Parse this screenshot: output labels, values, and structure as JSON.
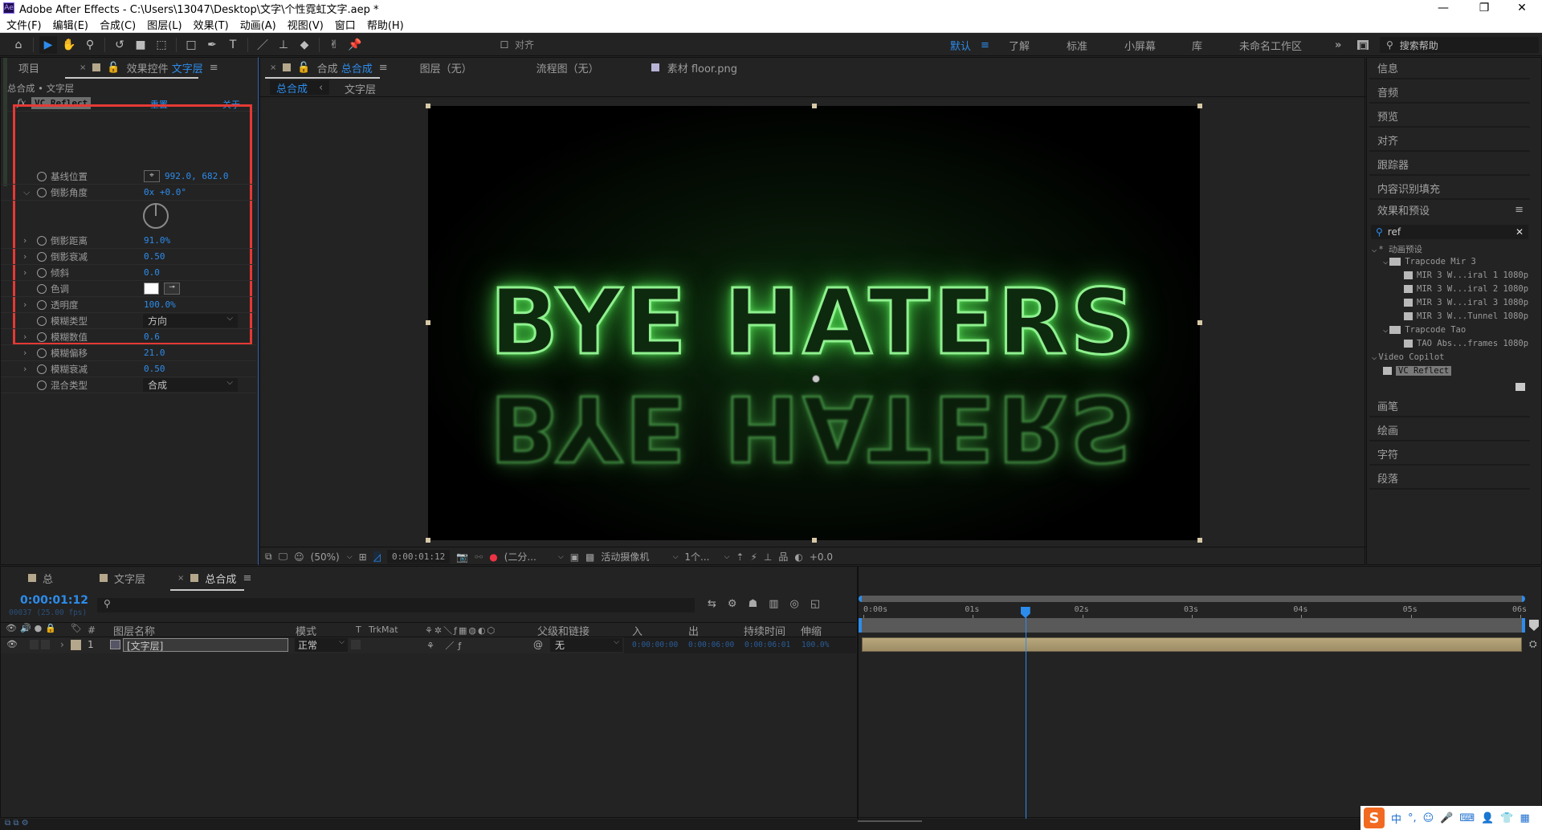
{
  "window": {
    "app_icon": "Ae",
    "title": "Adobe After Effects - C:\\Users\\13047\\Desktop\\文字\\个性霓虹文字.aep *",
    "controls": {
      "minimize": "—",
      "restore": "❐",
      "close": "✕"
    }
  },
  "menu": [
    "文件(F)",
    "编辑(E)",
    "合成(C)",
    "图层(L)",
    "效果(T)",
    "动画(A)",
    "视图(V)",
    "窗口",
    "帮助(H)"
  ],
  "toolbar": {
    "align_label": "对齐",
    "workspaces": [
      {
        "label": "默认",
        "active": true
      },
      {
        "label": "了解",
        "active": false
      },
      {
        "label": "标准",
        "active": false
      },
      {
        "label": "小屏幕",
        "active": false
      },
      {
        "label": "库",
        "active": false
      },
      {
        "label": "未命名工作区",
        "active": false
      }
    ],
    "more": "»",
    "search_help_placeholder": "搜索帮助"
  },
  "left_panel": {
    "tab_project": "项目",
    "tab_effects_prefix": "效果控件",
    "tab_effects_layer": "文字层",
    "breadcrumb": "总合成 • 文字层",
    "effect_name": "VC Reflect",
    "reset_label": "重置",
    "about_label": "关于",
    "properties": [
      {
        "label": "基线位置",
        "value": "992.0, 682.0",
        "type": "point",
        "expandable": false
      },
      {
        "label": "倒影角度",
        "value": "0x +0.0°",
        "type": "angle",
        "expandable": true,
        "expanded": true
      },
      {
        "label": "倒影距离",
        "value": "91.0%",
        "type": "number",
        "expandable": true
      },
      {
        "label": "倒影衰减",
        "value": "0.50",
        "type": "number",
        "expandable": true
      },
      {
        "label": "倾斜",
        "value": "0.0",
        "type": "number",
        "expandable": true
      },
      {
        "label": "色调",
        "value": "#ffffff",
        "type": "color",
        "expandable": false
      },
      {
        "label": "透明度",
        "value": "100.0%",
        "type": "number",
        "expandable": true
      },
      {
        "label": "模糊类型",
        "value": "方向",
        "type": "dropdown",
        "expandable": false
      },
      {
        "label": "模糊数值",
        "value": "0.6",
        "type": "number",
        "expandable": true
      },
      {
        "label": "模糊偏移",
        "value": "21.0",
        "type": "number",
        "expandable": true
      },
      {
        "label": "模糊衰减",
        "value": "0.50",
        "type": "number",
        "expandable": true
      },
      {
        "label": "混合类型",
        "value": "合成",
        "type": "dropdown",
        "expandable": false
      }
    ]
  },
  "viewer": {
    "tab_comp_prefix": "合成",
    "tab_comp_name": "总合成",
    "tab_layer": "图层（无）",
    "tab_flow": "流程图（无）",
    "tab_footage": "素材 floor.png",
    "crumb_active": "总合成",
    "crumb_next": "文字层",
    "canvas_text": "BYE HATERS",
    "footer": {
      "zoom": "(50%)",
      "timecode": "0:00:01:12",
      "resolution": "(二分...",
      "camera": "活动摄像机",
      "views": "1个...",
      "exposure": "+0.0"
    }
  },
  "right_panel": {
    "items_top": [
      "信息",
      "音频",
      "预览",
      "对齐",
      "跟踪器",
      "内容识别填充"
    ],
    "effects_title": "效果和预设",
    "search_value": "ref",
    "tree": [
      {
        "level": 0,
        "label": "* 动画预设",
        "kind": "group"
      },
      {
        "level": 1,
        "label": "Trapcode Mir 3",
        "kind": "folder"
      },
      {
        "level": 2,
        "label": "MIR 3 W...iral 1 1080p",
        "kind": "preset"
      },
      {
        "level": 2,
        "label": "MIR 3 W...iral 2 1080p",
        "kind": "preset"
      },
      {
        "level": 2,
        "label": "MIR 3 W...iral 3 1080p",
        "kind": "preset"
      },
      {
        "level": 2,
        "label": "MIR 3 W...Tunnel 1080p",
        "kind": "preset"
      },
      {
        "level": 1,
        "label": "Trapcode Tao",
        "kind": "folder"
      },
      {
        "level": 2,
        "label": "TAO Abs...frames 1080p",
        "kind": "preset"
      },
      {
        "level": 0,
        "label": "Video Copilot",
        "kind": "group"
      },
      {
        "level": 1,
        "label": "VC Reflect",
        "kind": "effect",
        "selected": true
      }
    ],
    "items_bottom": [
      "画笔",
      "绘画",
      "字符",
      "段落"
    ]
  },
  "timeline": {
    "tabs": [
      {
        "label": "总",
        "active": false
      },
      {
        "label": "文字层",
        "active": false
      },
      {
        "label": "总合成",
        "active": true
      }
    ],
    "timecode": "0:00:01:12",
    "frame_info": "00037 (25.00 fps)",
    "columns": {
      "num": "#",
      "name": "图层名称",
      "mode": "模式",
      "t": "T",
      "trkmat": "TrkMat",
      "parent": "父级和链接",
      "in": "入",
      "out": "出",
      "duration": "持续时间",
      "stretch": "伸缩"
    },
    "layers": [
      {
        "num": "1",
        "name": "[文字层]",
        "mode": "正常",
        "parent": "无",
        "in": "0:00:00:00",
        "out": "0:00:06:00",
        "duration": "0:00:06:01",
        "stretch": "100.0%"
      }
    ],
    "ruler": [
      "0:00s",
      "01s",
      "02s",
      "03s",
      "04s",
      "05s",
      "06s"
    ],
    "playhead_seconds": 1.48,
    "duration_seconds": 6
  },
  "taskbar": {
    "ime": [
      "S",
      "中",
      "°,",
      "☺",
      "🎤",
      "⌨",
      "👤",
      "👕",
      "▦"
    ]
  },
  "colors": {
    "accent": "#2d8ceb",
    "highlight_box": "#e53935",
    "layer_bar": "#a8986f",
    "glow": "#6fe36f"
  }
}
